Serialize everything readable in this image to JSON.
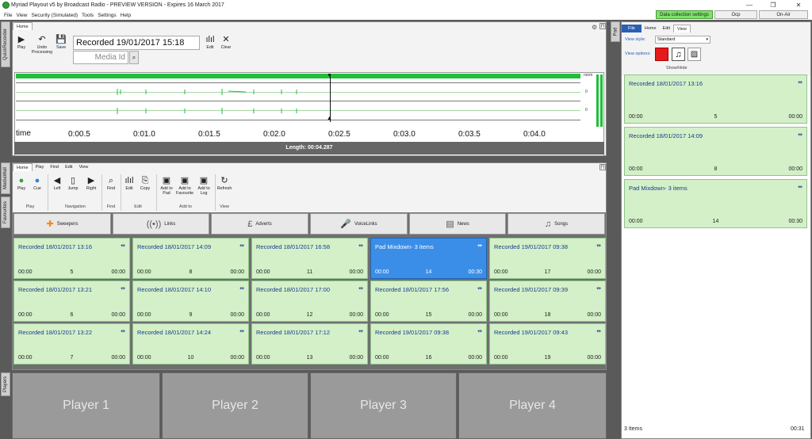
{
  "app": {
    "title": "Myriad Playout v5 by Broadcast Radio - PREVIEW VERSION - Expires 16 March 2017"
  },
  "window": {
    "minimize": "—",
    "maximize": "❐",
    "close": "✕"
  },
  "menu": [
    "File",
    "View",
    "Security (Simulated)",
    "Tools",
    "Settings",
    "Help"
  ],
  "top_buttons": {
    "data": "Data collection settings",
    "ocp": "Ocp",
    "onair": "On-Air"
  },
  "side_tabs": {
    "quick": "QuickRecorder",
    "media": "MediaWall",
    "fav": "Favourites",
    "players": "Players",
    "pad": "Pad"
  },
  "recorder": {
    "tab": "Home",
    "play": "Play",
    "undo": "Undo Processing",
    "save": "Save",
    "title_value": "Recorded 19/01/2017 15:18",
    "media_placeholder": "Media Id",
    "edit": "Edit",
    "clear": "Clear",
    "norm": "norm",
    "zero1": "0",
    "zero2": "0",
    "time_label": "time",
    "ticks": [
      "0:00.5",
      "0:01.0",
      "0:01.5",
      "0:02.0",
      "0:02.5",
      "0:03.0",
      "0:03.5",
      "0:04.0"
    ],
    "length": "Length:  00:04.287"
  },
  "mediawall": {
    "tabs": [
      "Home",
      "Play",
      "Find",
      "Edit",
      "View"
    ],
    "buttons": {
      "play": "Play",
      "cue": "Cue",
      "left": "Left",
      "jump": "Jump",
      "right": "Right",
      "find": "Find",
      "edit": "Edit",
      "copy": "Copy",
      "add_pad": "Add to Pad",
      "add_fav": "Add to Favourite",
      "add_log": "Add to Log",
      "refresh": "Refresh"
    },
    "groups": {
      "play": "Play",
      "nav": "Navigation",
      "find": "Find",
      "edit": "Edit",
      "addto": "Add to",
      "view": "View"
    },
    "categories": [
      {
        "label": "Sweepers",
        "icon": "✚"
      },
      {
        "label": "Links",
        "icon": "((•))"
      },
      {
        "label": "Adverts",
        "icon": "£"
      },
      {
        "label": "VoiceLinks",
        "icon": "🎤"
      },
      {
        "label": "News",
        "icon": "▤"
      },
      {
        "label": "Songs",
        "icon": "♫"
      }
    ],
    "carts": [
      {
        "title": "Recorded 18/01/2017 13:16",
        "a": "00:00",
        "n": "5",
        "b": "00:00"
      },
      {
        "title": "Recorded 18/01/2017 14:09",
        "a": "00:00",
        "n": "8",
        "b": "00:00"
      },
      {
        "title": "Recorded 18/01/2017 16:58",
        "a": "00:00",
        "n": "11",
        "b": "00:00"
      },
      {
        "title": "Pad Mixdown- 3 items",
        "a": "00:00",
        "n": "14",
        "b": "00:30"
      },
      {
        "title": "Recorded 19/01/2017 09:38",
        "a": "00:00",
        "n": "17",
        "b": "00:00"
      },
      {
        "title": "Recorded 18/01/2017 13:21",
        "a": "00:00",
        "n": "6",
        "b": "00:00"
      },
      {
        "title": "Recorded 18/01/2017 14:10",
        "a": "00:00",
        "n": "9",
        "b": "00:00"
      },
      {
        "title": "Recorded 18/01/2017 17:00",
        "a": "00:00",
        "n": "12",
        "b": "00:00"
      },
      {
        "title": "Recorded 18/01/2017 17:56",
        "a": "00:00",
        "n": "15",
        "b": "00:00"
      },
      {
        "title": "Recorded 19/01/2017 09:39",
        "a": "00:00",
        "n": "18",
        "b": "00:00"
      },
      {
        "title": "Recorded 18/01/2017 13:22",
        "a": "00:00",
        "n": "7",
        "b": "00:00"
      },
      {
        "title": "Recorded 18/01/2017 14:24",
        "a": "00:00",
        "n": "10",
        "b": "00:00"
      },
      {
        "title": "Recorded 18/01/2017 17:12",
        "a": "00:00",
        "n": "13",
        "b": "00:00"
      },
      {
        "title": "Recorded 19/01/2017 09:38",
        "a": "00:00",
        "n": "16",
        "b": "00:00"
      },
      {
        "title": "Recorded 19/01/2017 09:43",
        "a": "00:00",
        "n": "19",
        "b": "00:00"
      }
    ],
    "selected_index": 3,
    "arrow": "⇹"
  },
  "players": [
    "Player 1",
    "Player 2",
    "Player 3",
    "Player 4"
  ],
  "pad": {
    "tabs": [
      "File",
      "Home",
      "Edit",
      "View"
    ],
    "view_style_label": "View style:",
    "view_style_value": "Standard",
    "view_options_label": "View options:",
    "show_hide": "Show/Hide",
    "items": [
      {
        "title": "Recorded 18/01/2017 13:16",
        "a": "00:00",
        "n": "5",
        "b": "00:00"
      },
      {
        "title": "Recorded 18/01/2017 14:09",
        "a": "00:00",
        "n": "8",
        "b": "00:00"
      },
      {
        "title": "Pad Mixdown- 3 items",
        "a": "00:00",
        "n": "14",
        "b": "00:30"
      }
    ],
    "count": "3 Items",
    "total": "00:31"
  },
  "colors": {
    "accent_blue": "#3b8ee8",
    "cart_green": "#d3f0c8",
    "wave_green": "#1fbf3a",
    "record_red": "#e41b1b"
  }
}
